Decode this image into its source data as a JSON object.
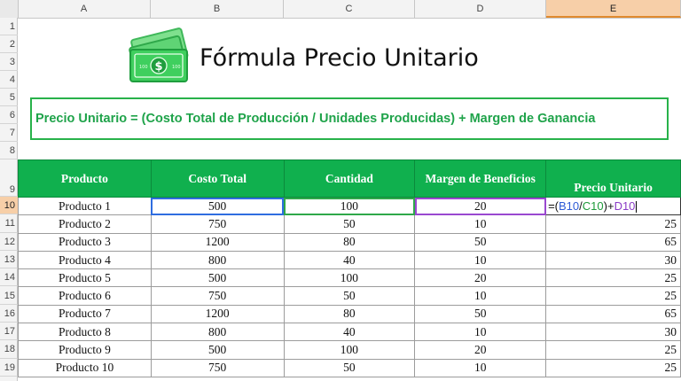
{
  "columns": [
    "A",
    "B",
    "C",
    "D",
    "E"
  ],
  "rows": [
    "1",
    "2",
    "3",
    "4",
    "5",
    "6",
    "7",
    "8",
    "9",
    "10",
    "11",
    "12",
    "13",
    "14",
    "15",
    "16",
    "17",
    "18",
    "19"
  ],
  "title": "Fórmula Precio Unitario",
  "formula_banner": "Precio Unitario = (Costo Total de Producción / Unidades Producidas) + Margen de Ganancia",
  "table": {
    "headers": [
      "Producto",
      "Costo Total",
      "Cantidad",
      "Margen de Beneficios",
      "Precio Unitario"
    ],
    "rows": [
      [
        "Producto 1",
        "500",
        "100",
        "20",
        ""
      ],
      [
        "Producto 2",
        "750",
        "50",
        "10",
        "25"
      ],
      [
        "Producto 3",
        "1200",
        "80",
        "50",
        "65"
      ],
      [
        "Producto 4",
        "800",
        "40",
        "10",
        "30"
      ],
      [
        "Producto 5",
        "500",
        "100",
        "20",
        "25"
      ],
      [
        "Producto 6",
        "750",
        "50",
        "10",
        "25"
      ],
      [
        "Producto 7",
        "1200",
        "80",
        "50",
        "65"
      ],
      [
        "Producto 8",
        "800",
        "40",
        "10",
        "30"
      ],
      [
        "Producto 9",
        "500",
        "100",
        "20",
        "25"
      ],
      [
        "Producto 10",
        "750",
        "50",
        "10",
        "25"
      ]
    ]
  },
  "editing_formula": {
    "open": "=(",
    "b_ref": "B10",
    "slash": "/",
    "c_ref": "C10",
    "close": ")+",
    "d_ref": "D10"
  },
  "colors": {
    "header_green": "#10b04e",
    "formula_green": "#1fa34a",
    "selected_header": "#f7cfa8"
  },
  "icons": {
    "money": "money-bill-icon"
  }
}
